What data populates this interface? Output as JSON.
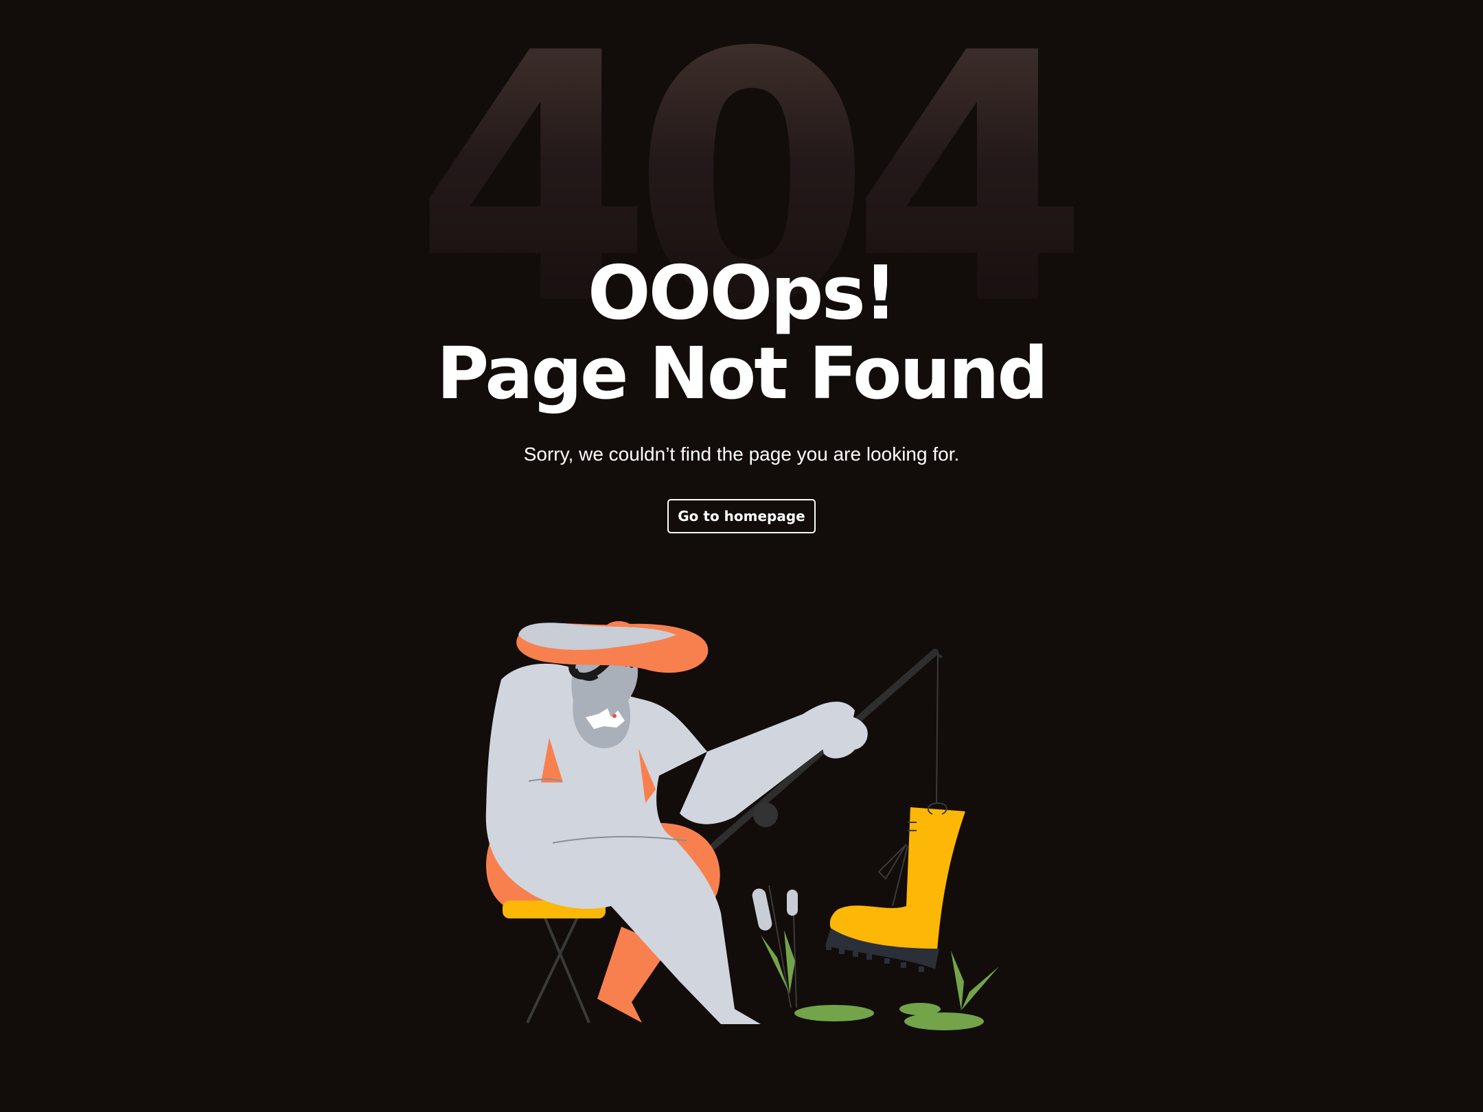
{
  "background_code": "404",
  "headline": {
    "line1": "OOOps!",
    "line2": "Page Not Found"
  },
  "message": "Sorry, we couldn’t find the page you are looking for.",
  "cta": {
    "label": "Go to homepage"
  },
  "illustration": {
    "icon": "fisherman-catching-boot-illustration",
    "colors": {
      "background": "#120d0b",
      "skin": "#d1d5de",
      "orange": "#f8804f",
      "yellow": "#fdb706",
      "grass": "#73a44a",
      "dark": "#2e2e2e"
    }
  }
}
